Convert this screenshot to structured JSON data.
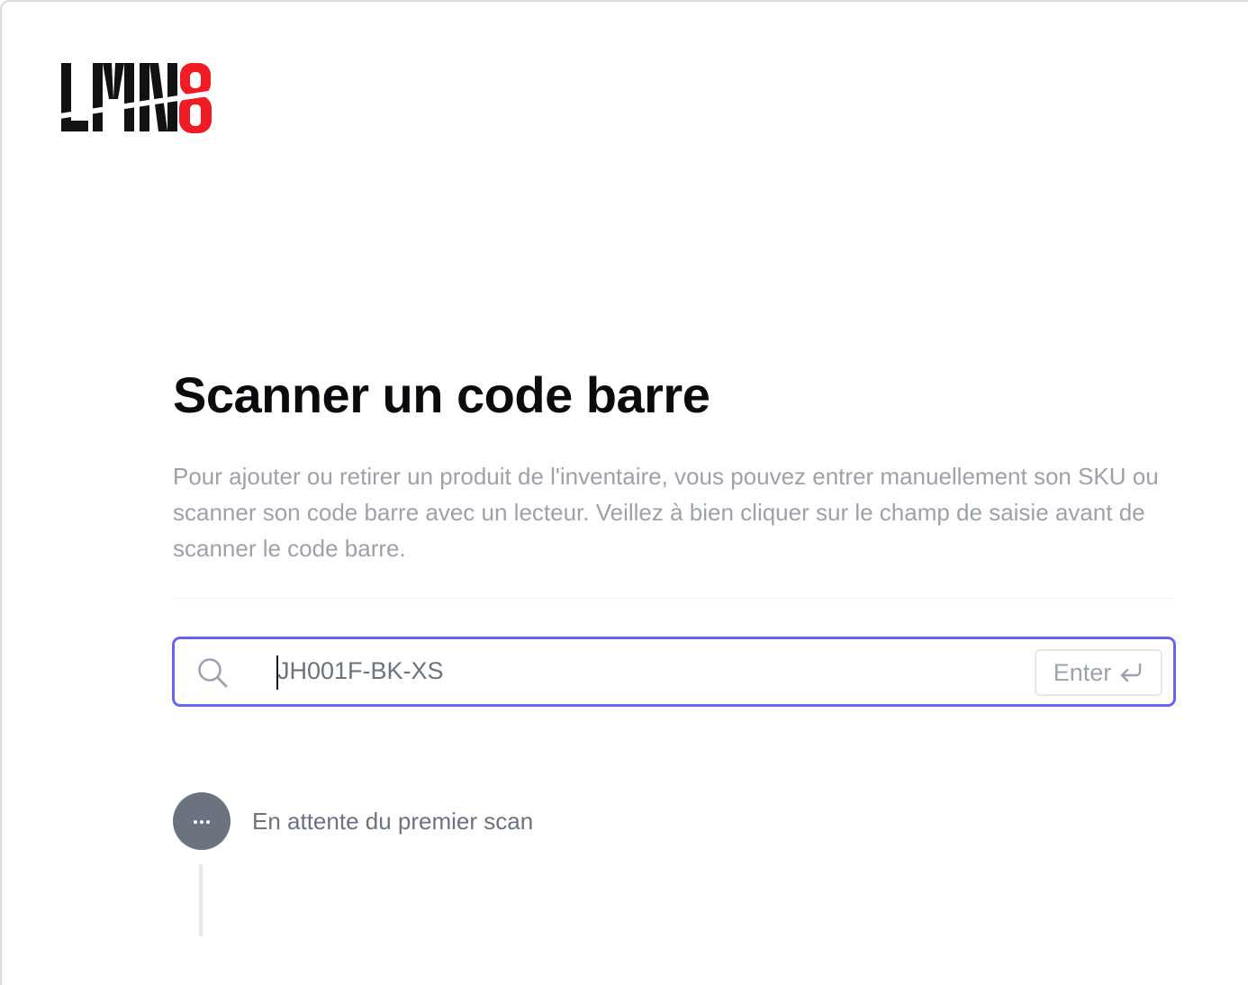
{
  "brand": {
    "logo_text_dark": "LMN",
    "logo_text_accent": "8",
    "dark_color": "#111111",
    "accent_color": "#ef1c25"
  },
  "page": {
    "title": "Scanner un code barre",
    "description": "Pour ajouter ou retirer un produit de l'inventaire, vous pouvez entrer manuellement son SKU ou scanner son code barre avec un lecteur. Veillez à bien cliquer sur le champ de saisie avant de scanner le code barre."
  },
  "search": {
    "icon": "search-icon",
    "value": "JH001F-BK-XS",
    "focus_color": "#6366f1",
    "enter_label": "Enter",
    "enter_icon": "return-arrow-icon"
  },
  "status": {
    "icon": "ellipsis-icon",
    "text": "En attente du premier scan",
    "dot_color": "#6b7280"
  }
}
